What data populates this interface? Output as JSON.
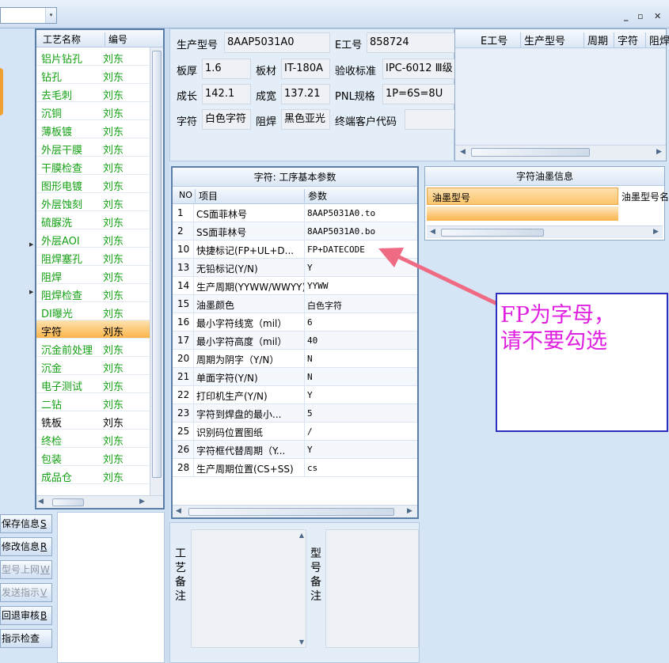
{
  "toolbar": {
    "combo_value": "",
    "combo_arrow": "▾"
  },
  "window_controls": {
    "minimize": "_",
    "restore": "▫",
    "close": "✕"
  },
  "process_list": {
    "headers": {
      "name": "工艺名称",
      "code": "编号"
    },
    "rows": [
      {
        "name": "铝片钻孔",
        "code": "刘东"
      },
      {
        "name": "钻孔",
        "code": "刘东"
      },
      {
        "name": "去毛刺",
        "code": "刘东"
      },
      {
        "name": "沉铜",
        "code": "刘东"
      },
      {
        "name": "薄板镀",
        "code": "刘东"
      },
      {
        "name": "外层干膜",
        "code": "刘东"
      },
      {
        "name": "干膜检查",
        "code": "刘东"
      },
      {
        "name": "图形电镀",
        "code": "刘东"
      },
      {
        "name": "外层蚀刻",
        "code": "刘东"
      },
      {
        "name": "硫脲洗",
        "code": "刘东"
      },
      {
        "name": "外层AOI",
        "code": "刘东"
      },
      {
        "name": "阻焊塞孔",
        "code": "刘东"
      },
      {
        "name": "阻焊",
        "code": "刘东"
      },
      {
        "name": "阻焊检查",
        "code": "刘东"
      },
      {
        "name": "DI曝光",
        "code": "刘东"
      },
      {
        "name": "字符",
        "code": "刘东",
        "selected": true
      },
      {
        "name": "沉金前处理",
        "code": "刘东"
      },
      {
        "name": "沉金",
        "code": "刘东"
      },
      {
        "name": "电子测试",
        "code": "刘东"
      },
      {
        "name": "二钻",
        "code": "刘东"
      },
      {
        "name": "铣板",
        "code": "刘东",
        "black": true
      },
      {
        "name": "终检",
        "code": "刘东"
      },
      {
        "name": "包装",
        "code": "刘东"
      },
      {
        "name": "成品仓",
        "code": "刘东"
      }
    ]
  },
  "left_buttons": [
    {
      "label": "保存信息",
      "key": "S",
      "enabled": true
    },
    {
      "label": "修改信息",
      "key": "R",
      "enabled": true
    },
    {
      "label": "型号上网",
      "key": "W",
      "enabled": false
    },
    {
      "label": "发送指示",
      "key": "V",
      "enabled": false
    },
    {
      "label": "回退审核",
      "key": "B",
      "enabled": true
    },
    {
      "label": "指示检查",
      "key": "",
      "enabled": true
    }
  ],
  "info": {
    "model_label": "生产型号",
    "model_value": "8AAP5031A0",
    "eno_label": "E工号",
    "eno_value": "858724",
    "thickness_label": "板厚",
    "thickness_value": "1.6",
    "material_label": "板材",
    "material_value": "IT-180A",
    "standard_label": "验收标准",
    "standard_value": "IPC-6012 Ⅲ级",
    "length_label": "成长",
    "length_value": "142.1",
    "width_label": "成宽",
    "width_value": "137.21",
    "pnl_label": "PNL规格",
    "pnl_value": "1P=6S=8U",
    "char_label": "字符",
    "char_value": "白色字符",
    "mask_label": "阻焊",
    "mask_value": "黑色亚光",
    "customer_label": "终端客户代码",
    "customer_value": ""
  },
  "right_table": {
    "headers": [
      "E工号",
      "生产型号",
      "周期",
      "字符",
      "阻焊"
    ]
  },
  "params": {
    "title": "字符: 工序基本参数",
    "headers": {
      "no": "NO",
      "item": "项目",
      "param": "参数"
    },
    "rows": [
      {
        "no": "1",
        "item": "CS面菲林号",
        "param": "8AAP5031A0.to"
      },
      {
        "no": "2",
        "item": "SS面菲林号",
        "param": "8AAP5031A0.bo"
      },
      {
        "no": "10",
        "item": "快捷标记(FP+UL+D...",
        "param": "FP+DATECODE"
      },
      {
        "no": "13",
        "item": "无铅标记(Y/N)",
        "param": "Y"
      },
      {
        "no": "14",
        "item": "生产周期(YYWW/WWYY)",
        "param": "YYWW"
      },
      {
        "no": "15",
        "item": "油墨颜色",
        "param": "白色字符"
      },
      {
        "no": "16",
        "item": "最小字符线宽（mil）",
        "param": "6"
      },
      {
        "no": "17",
        "item": "最小字符高度（mil）",
        "param": "40"
      },
      {
        "no": "20",
        "item": "周期为阴字（Y/N）",
        "param": "N"
      },
      {
        "no": "21",
        "item": "单面字符(Y/N)",
        "param": "N"
      },
      {
        "no": "22",
        "item": "打印机生产(Y/N)",
        "param": "Y"
      },
      {
        "no": "23",
        "item": "字符到焊盘的最小...",
        "param": "5"
      },
      {
        "no": "25",
        "item": "识别码位置图纸",
        "param": "/"
      },
      {
        "no": "26",
        "item": "字符框代替周期（Y...",
        "param": "Y"
      },
      {
        "no": "28",
        "item": "生产周期位置(CS+SS)",
        "param": "cs"
      }
    ]
  },
  "ink": {
    "title": "字符油墨信息",
    "col1": "油墨型号",
    "col2": "油墨型号名"
  },
  "remarks": {
    "process_label": "工艺备注",
    "model_label": "型号备注"
  },
  "annotation": {
    "line1": "FP为字母，",
    "line2": "请不要勾选"
  },
  "colors": {
    "accent_green": "#14a014",
    "selection_orange": "#fbb44a",
    "arrow_pink": "#ef6b84",
    "note_magenta": "#e020e0",
    "note_border": "#2c2ec0"
  }
}
